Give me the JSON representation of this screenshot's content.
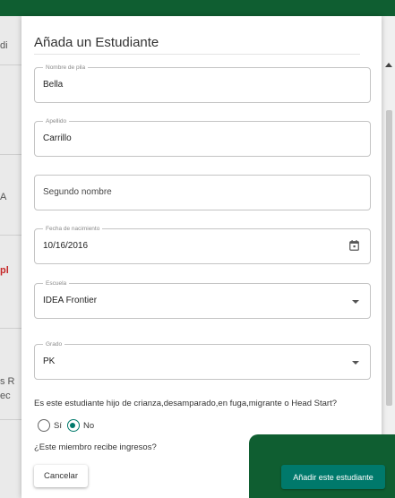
{
  "background": {
    "fragments": [
      "di",
      "A",
      "pl",
      "s R",
      "ec"
    ]
  },
  "modal": {
    "title": "Añada un Estudiante",
    "fields": {
      "first_name": {
        "label": "Nombre de pila",
        "value": "Bella"
      },
      "last_name": {
        "label": "Apellido",
        "value": "Carrillo"
      },
      "middle_name": {
        "placeholder": "Segundo nombre"
      },
      "birth_date": {
        "label": "Fecha de nacimiento",
        "value": "10/16/2016"
      },
      "school": {
        "label": "Escuela",
        "value": "IDEA Frontier"
      },
      "grade": {
        "label": "Grado",
        "value": "PK"
      }
    },
    "question": "Es este estudiante hijo de crianza,desamparado,en fuga,migrante o Head Start?",
    "radio": {
      "yes": "Sí",
      "no": "No",
      "selected": "No"
    },
    "income_question": "¿Este miembro recibe ingresos?",
    "cancel_label": "Cancelar",
    "add_label": "Añadir este estudiante"
  },
  "colors": {
    "brand_green": "#0f5e31",
    "accent_teal": "#00796b"
  },
  "icons": {
    "date": "calendar-icon",
    "dropdown": "caret-down-icon",
    "scroll": "scroll-up-arrow-icon"
  }
}
